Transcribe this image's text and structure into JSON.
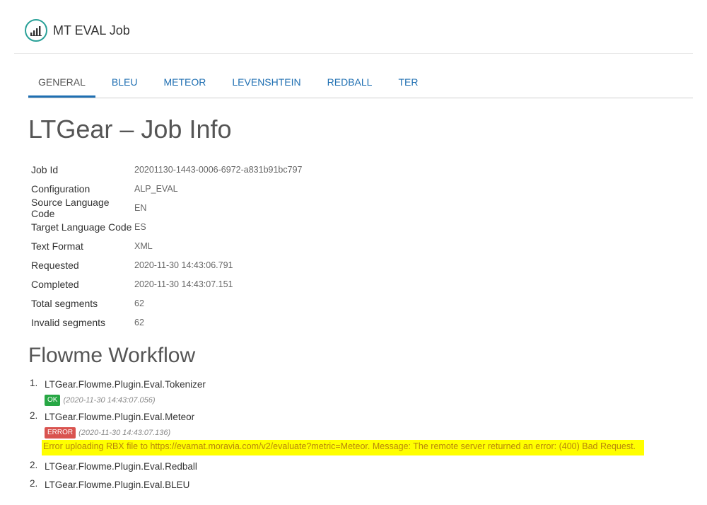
{
  "app": {
    "title": "MT EVAL Job"
  },
  "tabs": [
    {
      "label": "GENERAL",
      "active": true
    },
    {
      "label": "BLEU"
    },
    {
      "label": "METEOR"
    },
    {
      "label": "LEVENSHTEIN"
    },
    {
      "label": "REDBALL"
    },
    {
      "label": "TER"
    }
  ],
  "page_title": "LTGear – Job Info",
  "job_info": [
    {
      "label": "Job Id",
      "value": "20201130-1443-0006-6972-a831b91bc797"
    },
    {
      "label": "Configuration",
      "value": "ALP_EVAL"
    },
    {
      "label": "Source Language Code",
      "value": "EN"
    },
    {
      "label": "Target Language Code",
      "value": "ES"
    },
    {
      "label": "Text Format",
      "value": "XML"
    },
    {
      "label": "Requested",
      "value": "2020-11-30 14:43:06.791"
    },
    {
      "label": "Completed",
      "value": "2020-11-30 14:43:07.151"
    },
    {
      "label": "Total segments",
      "value": "62"
    },
    {
      "label": "Invalid segments",
      "value": "62"
    }
  ],
  "workflow": {
    "title": "Flowme Workflow",
    "steps": [
      {
        "num": "1.",
        "name": "LTGear.Flowme.Plugin.Eval.Tokenizer",
        "status": "OK",
        "timestamp": "(2020-11-30 14:43:07.056)"
      },
      {
        "num": "2.",
        "name": "LTGear.Flowme.Plugin.Eval.Meteor",
        "status": "ERROR",
        "timestamp": "(2020-11-30 14:43:07.136)",
        "error": "Error uploading RBX file to https://evamat.moravia.com/v2/evaluate?metric=Meteor. Message: The remote server returned an error: (400) Bad Request."
      },
      {
        "num": "2.",
        "name": "LTGear.Flowme.Plugin.Eval.Redball"
      },
      {
        "num": "2.",
        "name": "LTGear.Flowme.Plugin.Eval.BLEU"
      }
    ]
  },
  "colors": {
    "accent": "#1f6fb2",
    "ok": "#27a744",
    "error": "#d9534f",
    "highlight": "#ffff00",
    "logo": "#2aa198"
  },
  "icons": {
    "logo": "bar-chart-icon"
  }
}
